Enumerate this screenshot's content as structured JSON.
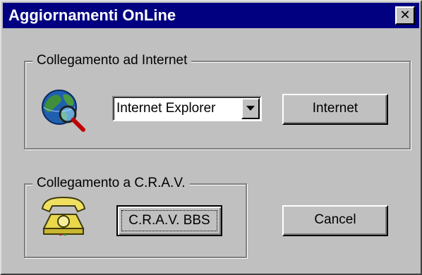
{
  "window": {
    "title": "Aggiornamenti OnLine",
    "close_icon": "close-icon"
  },
  "internet_group": {
    "label": "Collegamento ad Internet",
    "icon": "globe-search-icon",
    "browser_select": {
      "value": "Internet Explorer",
      "arrow_icon": "chevron-down-icon"
    },
    "internet_button": "Internet"
  },
  "crav_group": {
    "label": "Collegamento a C.R.A.V.",
    "icon": "telephone-icon",
    "bbs_button": "C.R.A.V. BBS"
  },
  "cancel_button": "Cancel",
  "colors": {
    "titlebar": "#000080",
    "title_text": "#ffffff",
    "face": "#c0c0c0"
  }
}
